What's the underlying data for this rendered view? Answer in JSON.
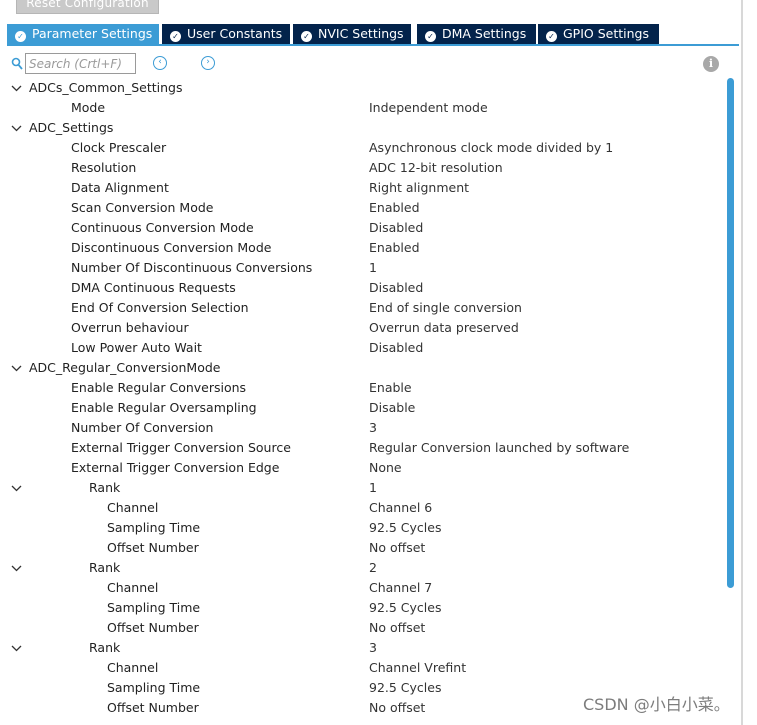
{
  "header": {
    "reset_label": "Reset Configuration"
  },
  "tabs": [
    {
      "label": "Parameter Settings",
      "active": true
    },
    {
      "label": "User Constants",
      "active": false
    },
    {
      "label": "NVIC Settings",
      "active": false
    },
    {
      "label": "DMA Settings",
      "active": false
    },
    {
      "label": "GPIO Settings",
      "active": false
    }
  ],
  "toolbar": {
    "search_placeholder": "Search (Crtl+F)"
  },
  "tree": [
    {
      "name": "ADCs_Common_Settings",
      "value": "",
      "expandable": true
    },
    {
      "name": "Mode",
      "value": "Independent mode",
      "expandable": false
    },
    {
      "name": "ADC_Settings",
      "value": "",
      "expandable": true
    },
    {
      "name": "Clock Prescaler",
      "value": "Asynchronous clock mode divided by 1",
      "expandable": false
    },
    {
      "name": "Resolution",
      "value": "ADC 12-bit resolution",
      "expandable": false
    },
    {
      "name": "Data Alignment",
      "value": "Right alignment",
      "expandable": false
    },
    {
      "name": "Scan Conversion Mode",
      "value": "Enabled",
      "expandable": false
    },
    {
      "name": "Continuous Conversion Mode",
      "value": "Disabled",
      "expandable": false
    },
    {
      "name": "Discontinuous Conversion Mode",
      "value": "Enabled",
      "expandable": false
    },
    {
      "name": "Number Of Discontinuous Conversions",
      "value": "1",
      "expandable": false
    },
    {
      "name": "DMA Continuous Requests",
      "value": "Disabled",
      "expandable": false
    },
    {
      "name": "End Of Conversion Selection",
      "value": "End of single conversion",
      "expandable": false
    },
    {
      "name": "Overrun behaviour",
      "value": "Overrun data preserved",
      "expandable": false
    },
    {
      "name": "Low Power Auto Wait",
      "value": "Disabled",
      "expandable": false
    },
    {
      "name": "ADC_Regular_ConversionMode",
      "value": "",
      "expandable": true
    },
    {
      "name": "Enable Regular Conversions",
      "value": "Enable",
      "expandable": false
    },
    {
      "name": "Enable Regular Oversampling",
      "value": "Disable",
      "expandable": false
    },
    {
      "name": "Number Of Conversion",
      "value": "3",
      "expandable": false
    },
    {
      "name": "External Trigger Conversion Source",
      "value": "Regular Conversion launched by software",
      "expandable": false
    },
    {
      "name": "External Trigger Conversion Edge",
      "value": "None",
      "expandable": false
    },
    {
      "name": "Rank",
      "value": "1",
      "expandable": true
    },
    {
      "name": "Channel",
      "value": "Channel 6",
      "expandable": false
    },
    {
      "name": "Sampling Time",
      "value": "92.5 Cycles",
      "expandable": false
    },
    {
      "name": "Offset Number",
      "value": "No offset",
      "expandable": false
    },
    {
      "name": "Rank",
      "value": "2",
      "expandable": true
    },
    {
      "name": "Channel",
      "value": "Channel 7",
      "expandable": false
    },
    {
      "name": "Sampling Time",
      "value": "92.5 Cycles",
      "expandable": false
    },
    {
      "name": "Offset Number",
      "value": "No offset",
      "expandable": false
    },
    {
      "name": "Rank",
      "value": "3",
      "expandable": true
    },
    {
      "name": "Channel",
      "value": "Channel Vrefint",
      "expandable": false
    },
    {
      "name": "Sampling Time",
      "value": "92.5 Cycles",
      "expandable": false
    },
    {
      "name": "Offset Number",
      "value": "No offset",
      "expandable": false
    }
  ],
  "watermark": "CSDN @小白小菜。",
  "colors": {
    "tab_active": "#3c9cd5",
    "tab_inactive": "#03234b",
    "scrollbar": "#3c9cd5"
  }
}
